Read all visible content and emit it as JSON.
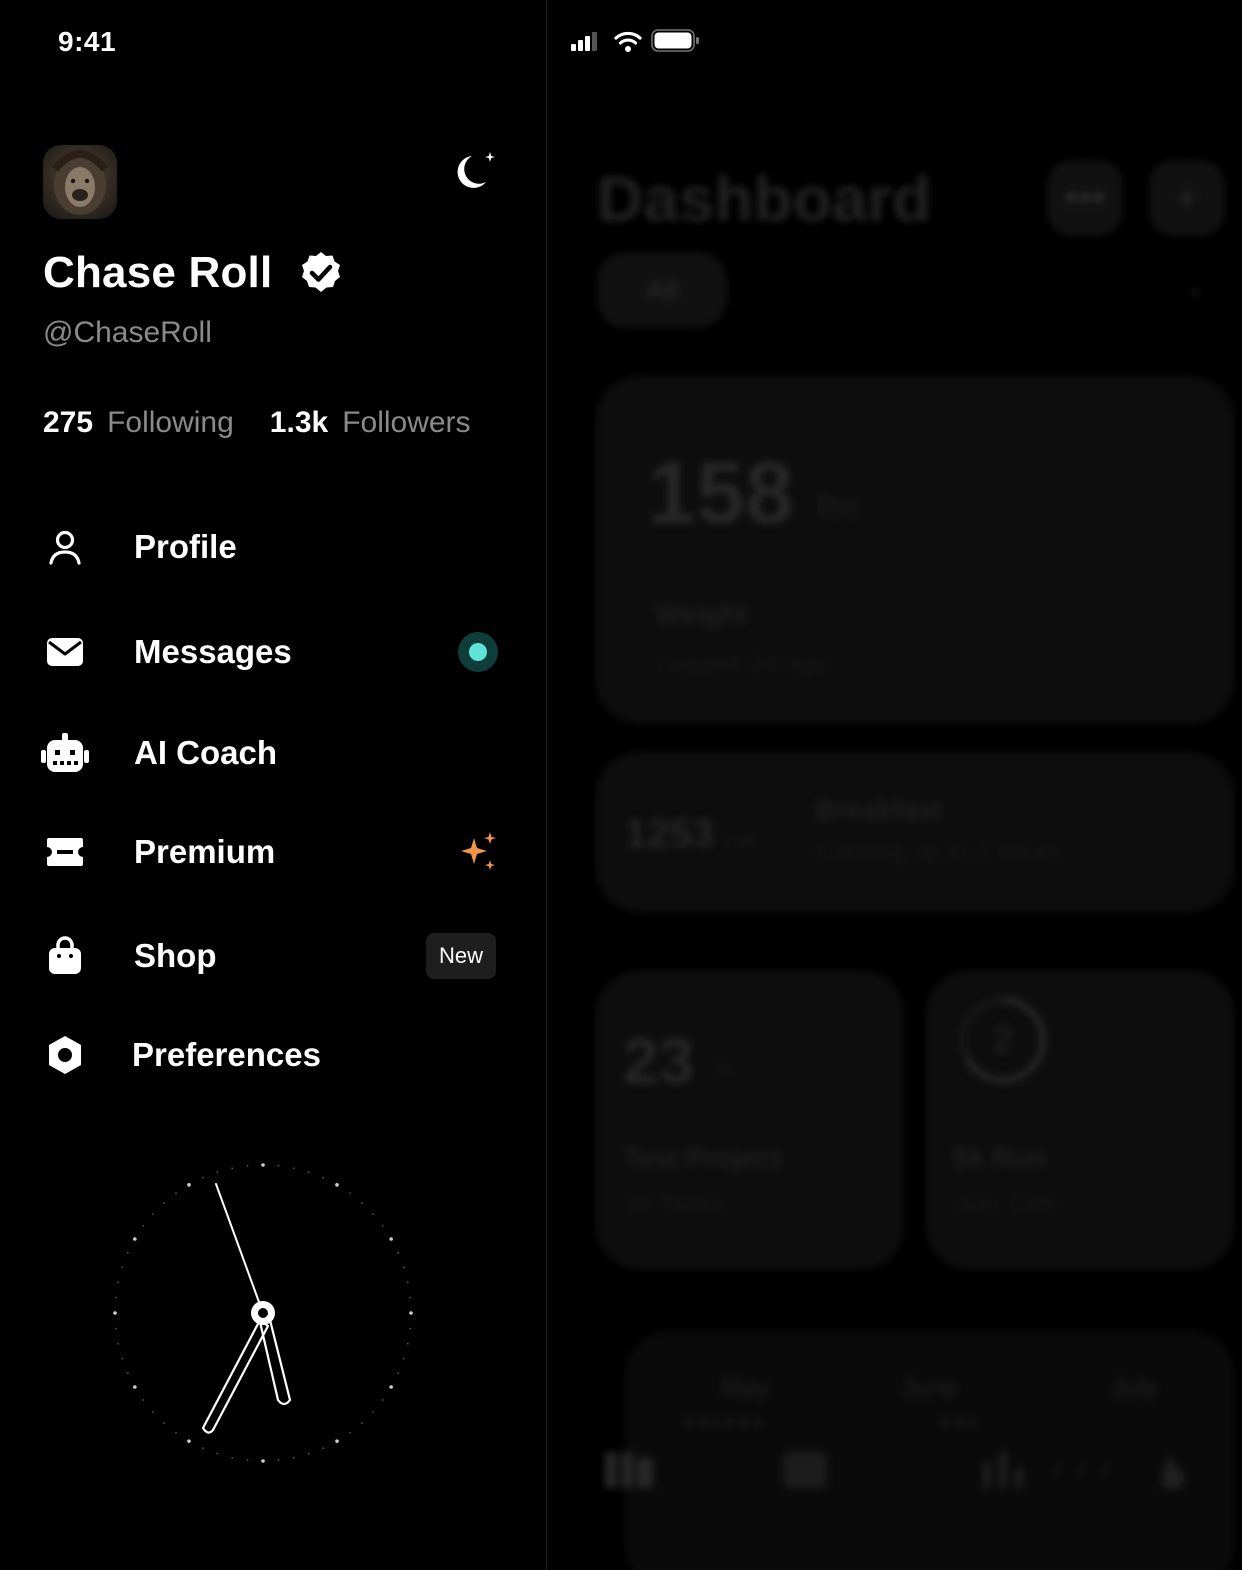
{
  "status_bar": {
    "time": "9:41"
  },
  "profile": {
    "name": "Chase Roll",
    "handle": "@ChaseRoll",
    "following_count": "275",
    "following_label": "Following",
    "followers_count": "1.3k",
    "followers_label": "Followers"
  },
  "menu": [
    {
      "label": "Profile",
      "icon": "person-icon"
    },
    {
      "label": "Messages",
      "icon": "envelope-icon",
      "indicator": "unread-dot"
    },
    {
      "label": "AI Coach",
      "icon": "robot-icon"
    },
    {
      "label": "Premium",
      "icon": "ticket-icon",
      "indicator": "sparkle-icon"
    },
    {
      "label": "Shop",
      "icon": "shopping-bag-icon",
      "badge": "New"
    },
    {
      "label": "Preferences",
      "icon": "hexagon-settings-icon"
    }
  ],
  "dashboard": {
    "title": "Dashboard",
    "filter": "All",
    "weight_value": "158",
    "weight_unit": "lbs",
    "weight_label": "Weight",
    "weight_sub": "Logged 2d ago",
    "meal_cal": "1253",
    "meal_cal_unit": "cal",
    "meal_title": "Breakfast",
    "meal_sub": "Coming up in 2 hours",
    "project_value": "23",
    "project_unit": "%",
    "project_title": "Test Project",
    "project_sub": "10 Tasks",
    "run_number": "2",
    "run_title": "5k Run",
    "run_sub": "July 13th",
    "months": [
      "May",
      "June",
      "July"
    ]
  },
  "colors": {
    "accent_teal": "#5fe3d6",
    "accent_orange": "#f0954a",
    "background": "#000000"
  }
}
